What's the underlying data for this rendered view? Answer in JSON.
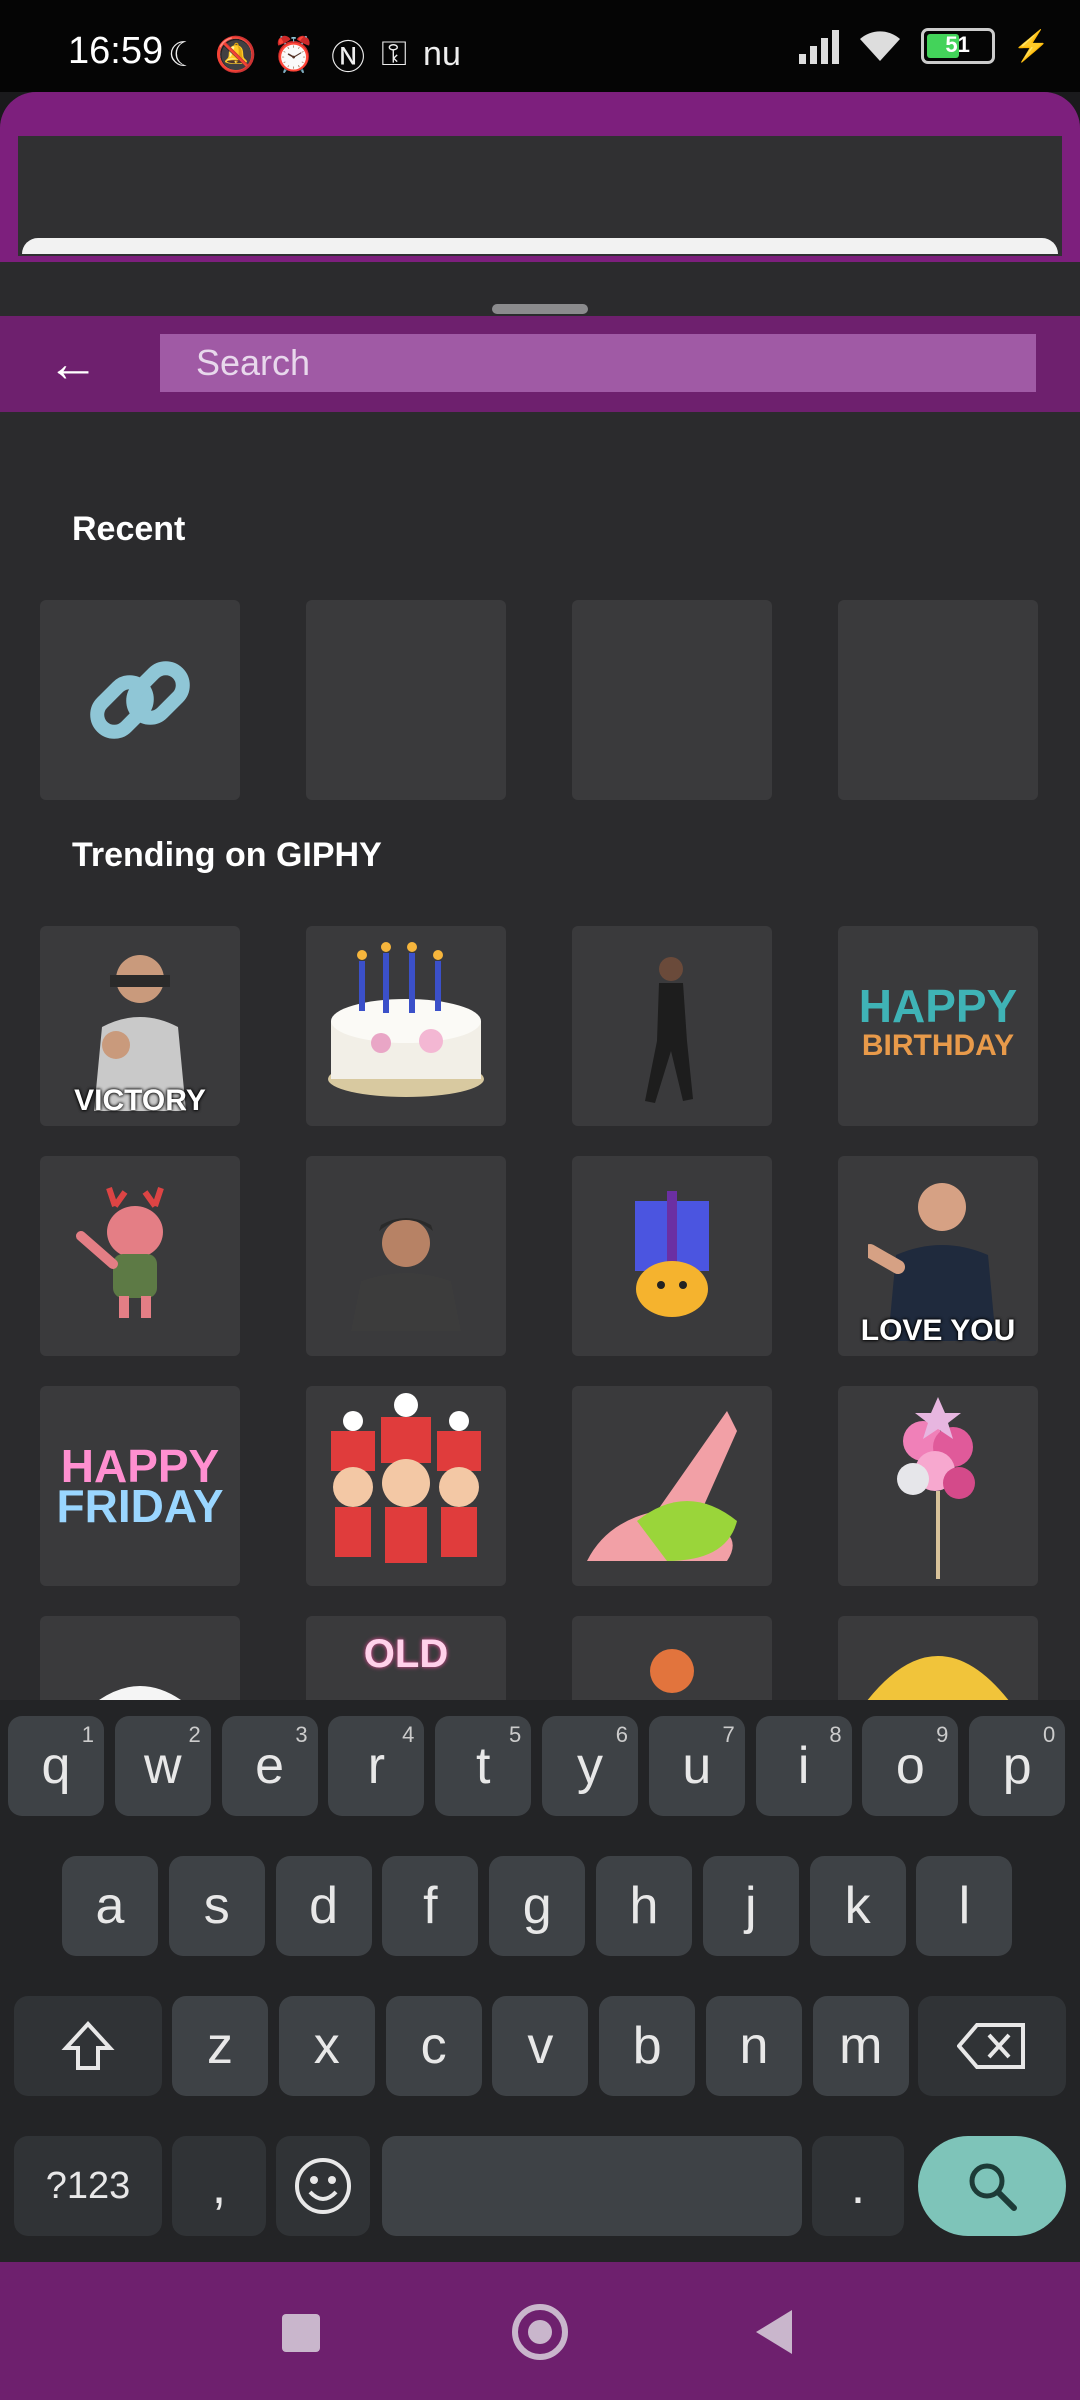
{
  "status_bar": {
    "time": "16:59",
    "left_icons": [
      "moon-icon",
      "mute-icon",
      "alarm-icon",
      "nfc-icon",
      "vpn-icon",
      "nu-icon"
    ],
    "nu_text": "nu",
    "battery_level": "51"
  },
  "search": {
    "placeholder": "Search"
  },
  "sections": {
    "recent": "Recent",
    "trending": "Trending on GIPHY"
  },
  "stickers": {
    "victory": "VICTORY",
    "happy_birthday_line1": "HAPPY",
    "happy_birthday_line2": "BIRTHDAY",
    "love_you": "LOVE YOU",
    "happy_friday_line1": "HAPPY",
    "happy_friday_line2": "FRIDAY",
    "old": "OLD"
  },
  "keyboard": {
    "row1": [
      {
        "k": "q",
        "h": "1"
      },
      {
        "k": "w",
        "h": "2"
      },
      {
        "k": "e",
        "h": "3"
      },
      {
        "k": "r",
        "h": "4"
      },
      {
        "k": "t",
        "h": "5"
      },
      {
        "k": "y",
        "h": "6"
      },
      {
        "k": "u",
        "h": "7"
      },
      {
        "k": "i",
        "h": "8"
      },
      {
        "k": "o",
        "h": "9"
      },
      {
        "k": "p",
        "h": "0"
      }
    ],
    "row2": [
      "a",
      "s",
      "d",
      "f",
      "g",
      "h",
      "j",
      "k",
      "l"
    ],
    "row3": [
      "z",
      "x",
      "c",
      "v",
      "b",
      "n",
      "m"
    ],
    "symbols": "?123",
    "comma": ",",
    "period": "."
  },
  "colors": {
    "overlay_magenta": "#7d1f7d",
    "panel_bg": "#2b2b2d",
    "key_bg": "#3e4246",
    "enter_key": "#7ec4b9"
  }
}
